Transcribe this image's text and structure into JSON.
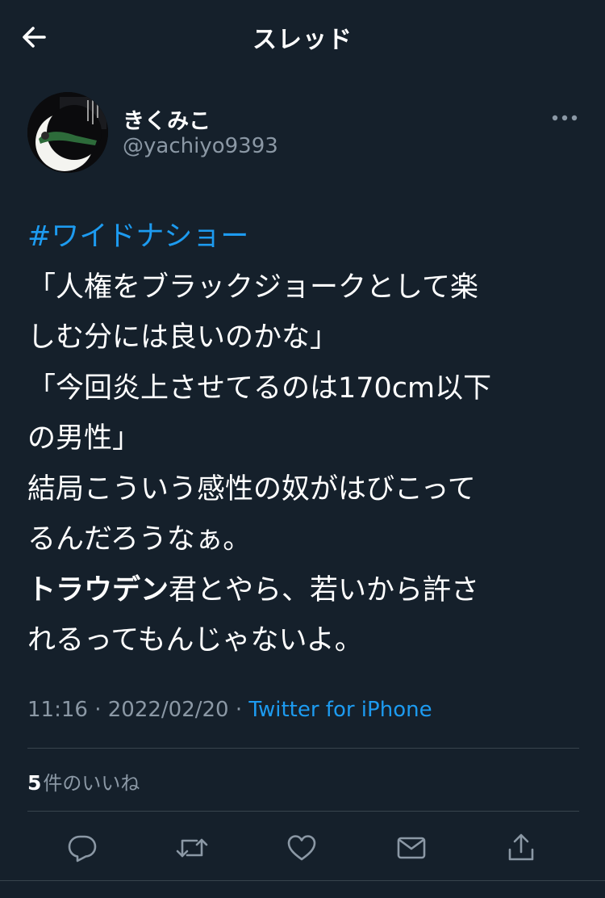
{
  "header": {
    "title": "スレッド",
    "back_icon": "arrow-left-icon"
  },
  "author": {
    "display_name": "きくみこ",
    "handle": "@yachiyo9393",
    "more_icon": "more-horizontal-icon"
  },
  "tweet": {
    "hashtag": "#ワイドナショー",
    "lines": [
      "「人権をブラックジョークとして楽",
      "しむ分には良いのかな」",
      "「今回炎上させてるのは170cm以下",
      "の男性」",
      "結局こういう感性の奴がはびこって",
      "るんだろうなぁ。"
    ],
    "bold_name": "トラウデン",
    "line_after_bold": "君とやら、若いから許さ",
    "last_line": "れるってもんじゃないよ。"
  },
  "meta": {
    "time": "11:16",
    "separator1": " · ",
    "date": "2022/02/20",
    "separator2": " · ",
    "source": "Twitter for iPhone"
  },
  "likes": {
    "count": "5",
    "label": "件のいいね"
  },
  "actions": {
    "reply_icon": "reply-icon",
    "retweet_icon": "retweet-icon",
    "like_icon": "heart-icon",
    "dm_icon": "mail-icon",
    "share_icon": "share-icon"
  },
  "colors": {
    "background": "#15202b",
    "text": "#ffffff",
    "secondary": "#8b98a5",
    "accent": "#1d9bf0",
    "divider": "#38444d"
  }
}
